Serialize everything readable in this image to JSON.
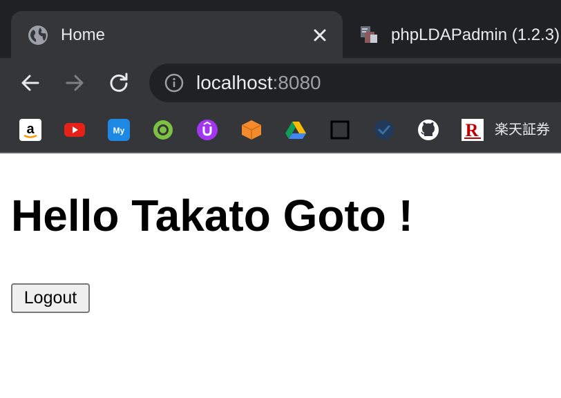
{
  "browser": {
    "tabs": [
      {
        "title": "Home",
        "favicon": "globe-icon",
        "active": true
      },
      {
        "title": "phpLDAPadmin (1.2.3)",
        "favicon": "phpldapadmin-icon",
        "active": false
      }
    ],
    "url": {
      "host": "localhost",
      "port": ":8080"
    },
    "bookmarks": [
      {
        "icon": "amazon-icon"
      },
      {
        "icon": "youtube-icon"
      },
      {
        "icon": "my-icon"
      },
      {
        "icon": "green-circle-icon"
      },
      {
        "icon": "udemy-icon"
      },
      {
        "icon": "orange-box-icon"
      },
      {
        "icon": "google-drive-icon"
      },
      {
        "icon": "square-icon"
      },
      {
        "icon": "blue-check-icon"
      },
      {
        "icon": "github-icon"
      },
      {
        "icon": "rakuten-icon",
        "label": "楽天証券"
      }
    ]
  },
  "page": {
    "heading": "Hello Takato Goto !",
    "logout_label": "Logout"
  }
}
